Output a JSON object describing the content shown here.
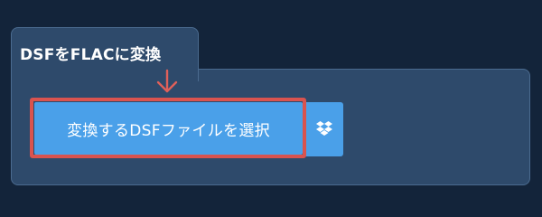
{
  "panel": {
    "title": "DSFをFLACに変換"
  },
  "upload": {
    "select_button_label": "変換するDSFファイルを選択"
  },
  "icons": {
    "arrow": "arrow-down-icon",
    "dropbox": "dropbox-icon"
  },
  "colors": {
    "page_background": "#13243a",
    "panel_background": "#2e4a6b",
    "panel_border": "#4b6b8f",
    "button_primary": "#4aa0e9",
    "highlight": "#d9534f"
  }
}
